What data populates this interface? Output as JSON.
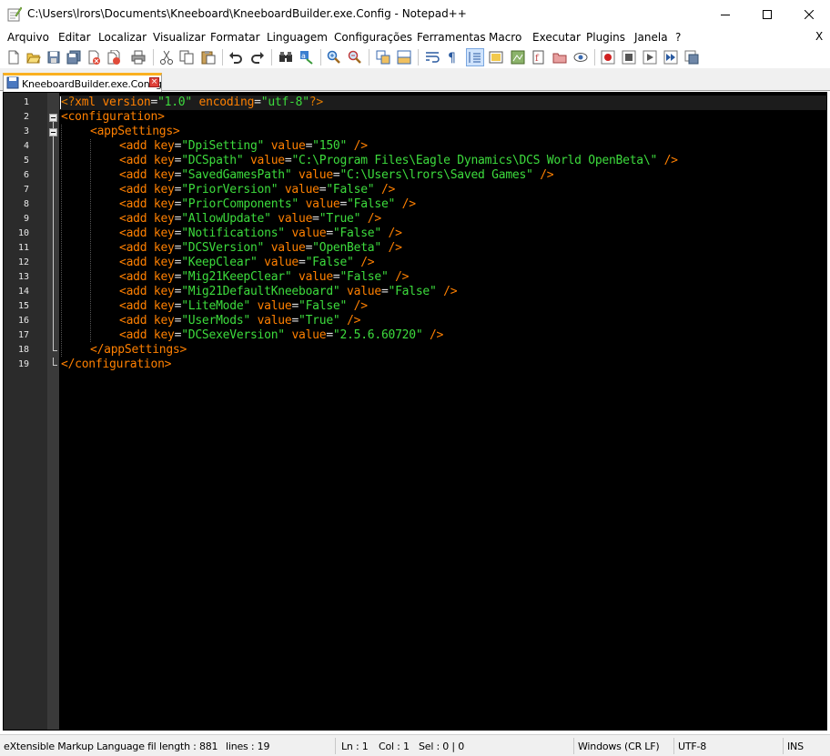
{
  "window": {
    "title": "C:\\Users\\lrors\\Documents\\Kneeboard\\KneeboardBuilder.exe.Config - Notepad++"
  },
  "menu": [
    "Arquivo",
    "Editar",
    "Localizar",
    "Visualizar",
    "Formatar",
    "Linguagem",
    "Configurações",
    "Ferramentas",
    "Macro",
    "Executar",
    "Plugins",
    "Janela",
    "?"
  ],
  "menu_close": "X",
  "toolbar_icons": [
    "new-file-icon",
    "open-file-icon",
    "save-icon",
    "save-all-icon",
    "close-icon",
    "close-all-icon",
    "print-icon",
    "cut-icon",
    "copy-icon",
    "paste-icon",
    "undo-icon",
    "redo-icon",
    "find-icon",
    "replace-icon",
    "zoom-in-icon",
    "zoom-out-icon",
    "sync-vertical-icon",
    "sync-horizontal-icon",
    "word-wrap-icon",
    "show-all-characters-icon",
    "indent-guide-icon",
    "user-language-icon",
    "document-map-icon",
    "function-list-icon",
    "folder-workspace-icon",
    "monitoring-icon",
    "record-macro-icon",
    "stop-recording-icon",
    "play-macro-icon",
    "run-macro-multiple-icon",
    "save-macro-icon"
  ],
  "tab": {
    "label": "KneeboardBuilder.exe.Config"
  },
  "editor": {
    "theme_colors": {
      "background": "#000000",
      "tag": "#ff8000",
      "string": "#3ddc3d",
      "attribute_operator": "#e0e0e0",
      "line_number": "#e8e8e8"
    },
    "lines": [
      {
        "n": "1",
        "fold": "none",
        "indent": 0,
        "tokens": [
          [
            "decl",
            "<?"
          ],
          [
            "attr",
            "xml version"
          ],
          [
            "op",
            "="
          ],
          [
            "str",
            "\"1.0\""
          ],
          [
            "op",
            " "
          ],
          [
            "attr",
            "encoding"
          ],
          [
            "op",
            "="
          ],
          [
            "str",
            "\"utf-8\""
          ],
          [
            "decl",
            "?>"
          ]
        ]
      },
      {
        "n": "2",
        "fold": "open",
        "indent": 0,
        "tokens": [
          [
            "tag",
            "<configuration>"
          ]
        ]
      },
      {
        "n": "3",
        "fold": "open",
        "indent": 1,
        "tokens": [
          [
            "tag",
            "<appSettings>"
          ]
        ]
      },
      {
        "n": "4",
        "fold": "line",
        "indent": 2,
        "tokens": [
          [
            "tag",
            "<add "
          ],
          [
            "attr",
            "key"
          ],
          [
            "op",
            "="
          ],
          [
            "str",
            "\"DpiSetting\""
          ],
          [
            "op",
            " "
          ],
          [
            "attr",
            "value"
          ],
          [
            "op",
            "="
          ],
          [
            "str",
            "\"150\""
          ],
          [
            "tag",
            " />"
          ]
        ]
      },
      {
        "n": "5",
        "fold": "line",
        "indent": 2,
        "tokens": [
          [
            "tag",
            "<add "
          ],
          [
            "attr",
            "key"
          ],
          [
            "op",
            "="
          ],
          [
            "str",
            "\"DCSpath\""
          ],
          [
            "op",
            " "
          ],
          [
            "attr",
            "value"
          ],
          [
            "op",
            "="
          ],
          [
            "str",
            "\"C:\\Program Files\\Eagle Dynamics\\DCS World OpenBeta\\\""
          ],
          [
            "tag",
            " />"
          ]
        ]
      },
      {
        "n": "6",
        "fold": "line",
        "indent": 2,
        "tokens": [
          [
            "tag",
            "<add "
          ],
          [
            "attr",
            "key"
          ],
          [
            "op",
            "="
          ],
          [
            "str",
            "\"SavedGamesPath\""
          ],
          [
            "op",
            " "
          ],
          [
            "attr",
            "value"
          ],
          [
            "op",
            "="
          ],
          [
            "str",
            "\"C:\\Users\\lrors\\Saved Games\""
          ],
          [
            "tag",
            " />"
          ]
        ]
      },
      {
        "n": "7",
        "fold": "line",
        "indent": 2,
        "tokens": [
          [
            "tag",
            "<add "
          ],
          [
            "attr",
            "key"
          ],
          [
            "op",
            "="
          ],
          [
            "str",
            "\"PriorVersion\""
          ],
          [
            "op",
            " "
          ],
          [
            "attr",
            "value"
          ],
          [
            "op",
            "="
          ],
          [
            "str",
            "\"False\""
          ],
          [
            "tag",
            " />"
          ]
        ]
      },
      {
        "n": "8",
        "fold": "line",
        "indent": 2,
        "tokens": [
          [
            "tag",
            "<add "
          ],
          [
            "attr",
            "key"
          ],
          [
            "op",
            "="
          ],
          [
            "str",
            "\"PriorComponents\""
          ],
          [
            "op",
            " "
          ],
          [
            "attr",
            "value"
          ],
          [
            "op",
            "="
          ],
          [
            "str",
            "\"False\""
          ],
          [
            "tag",
            " />"
          ]
        ]
      },
      {
        "n": "9",
        "fold": "line",
        "indent": 2,
        "tokens": [
          [
            "tag",
            "<add "
          ],
          [
            "attr",
            "key"
          ],
          [
            "op",
            "="
          ],
          [
            "str",
            "\"AllowUpdate\""
          ],
          [
            "op",
            " "
          ],
          [
            "attr",
            "value"
          ],
          [
            "op",
            "="
          ],
          [
            "str",
            "\"True\""
          ],
          [
            "tag",
            " />"
          ]
        ]
      },
      {
        "n": "10",
        "fold": "line",
        "indent": 2,
        "tokens": [
          [
            "tag",
            "<add "
          ],
          [
            "attr",
            "key"
          ],
          [
            "op",
            "="
          ],
          [
            "str",
            "\"Notifications\""
          ],
          [
            "op",
            " "
          ],
          [
            "attr",
            "value"
          ],
          [
            "op",
            "="
          ],
          [
            "str",
            "\"False\""
          ],
          [
            "tag",
            " />"
          ]
        ]
      },
      {
        "n": "11",
        "fold": "line",
        "indent": 2,
        "tokens": [
          [
            "tag",
            "<add "
          ],
          [
            "attr",
            "key"
          ],
          [
            "op",
            "="
          ],
          [
            "str",
            "\"DCSVersion\""
          ],
          [
            "op",
            " "
          ],
          [
            "attr",
            "value"
          ],
          [
            "op",
            "="
          ],
          [
            "str",
            "\"OpenBeta\""
          ],
          [
            "tag",
            " />"
          ]
        ]
      },
      {
        "n": "12",
        "fold": "line",
        "indent": 2,
        "tokens": [
          [
            "tag",
            "<add "
          ],
          [
            "attr",
            "key"
          ],
          [
            "op",
            "="
          ],
          [
            "str",
            "\"KeepClear\""
          ],
          [
            "op",
            " "
          ],
          [
            "attr",
            "value"
          ],
          [
            "op",
            "="
          ],
          [
            "str",
            "\"False\""
          ],
          [
            "tag",
            " />"
          ]
        ]
      },
      {
        "n": "13",
        "fold": "line",
        "indent": 2,
        "tokens": [
          [
            "tag",
            "<add "
          ],
          [
            "attr",
            "key"
          ],
          [
            "op",
            "="
          ],
          [
            "str",
            "\"Mig21KeepClear\""
          ],
          [
            "op",
            " "
          ],
          [
            "attr",
            "value"
          ],
          [
            "op",
            "="
          ],
          [
            "str",
            "\"False\""
          ],
          [
            "tag",
            " />"
          ]
        ]
      },
      {
        "n": "14",
        "fold": "line",
        "indent": 2,
        "tokens": [
          [
            "tag",
            "<add "
          ],
          [
            "attr",
            "key"
          ],
          [
            "op",
            "="
          ],
          [
            "str",
            "\"Mig21DefaultKneeboard\""
          ],
          [
            "op",
            " "
          ],
          [
            "attr",
            "value"
          ],
          [
            "op",
            "="
          ],
          [
            "str",
            "\"False\""
          ],
          [
            "tag",
            " />"
          ]
        ]
      },
      {
        "n": "15",
        "fold": "line",
        "indent": 2,
        "tokens": [
          [
            "tag",
            "<add "
          ],
          [
            "attr",
            "key"
          ],
          [
            "op",
            "="
          ],
          [
            "str",
            "\"LiteMode\""
          ],
          [
            "op",
            " "
          ],
          [
            "attr",
            "value"
          ],
          [
            "op",
            "="
          ],
          [
            "str",
            "\"False\""
          ],
          [
            "tag",
            " />"
          ]
        ]
      },
      {
        "n": "16",
        "fold": "line",
        "indent": 2,
        "tokens": [
          [
            "tag",
            "<add "
          ],
          [
            "attr",
            "key"
          ],
          [
            "op",
            "="
          ],
          [
            "str",
            "\"UserMods\""
          ],
          [
            "op",
            " "
          ],
          [
            "attr",
            "value"
          ],
          [
            "op",
            "="
          ],
          [
            "str",
            "\"True\""
          ],
          [
            "tag",
            " />"
          ]
        ]
      },
      {
        "n": "17",
        "fold": "line",
        "indent": 2,
        "tokens": [
          [
            "tag",
            "<add "
          ],
          [
            "attr",
            "key"
          ],
          [
            "op",
            "="
          ],
          [
            "str",
            "\"DCSexeVersion\""
          ],
          [
            "op",
            " "
          ],
          [
            "attr",
            "value"
          ],
          [
            "op",
            "="
          ],
          [
            "str",
            "\"2.5.6.60720\""
          ],
          [
            "tag",
            " />"
          ]
        ]
      },
      {
        "n": "18",
        "fold": "end",
        "indent": 1,
        "tokens": [
          [
            "tag",
            "</appSettings>"
          ]
        ]
      },
      {
        "n": "19",
        "fold": "end",
        "indent": 0,
        "tokens": [
          [
            "tag",
            "</configuration>"
          ]
        ]
      }
    ]
  },
  "status": {
    "language": "eXtensible Markup Language fil",
    "length": "length : 881",
    "lines": "lines : 19",
    "ln": "Ln : 1",
    "col": "Col : 1",
    "sel": "Sel : 0 | 0",
    "eol": "Windows (CR LF)",
    "encoding": "UTF-8",
    "mode": "INS"
  }
}
